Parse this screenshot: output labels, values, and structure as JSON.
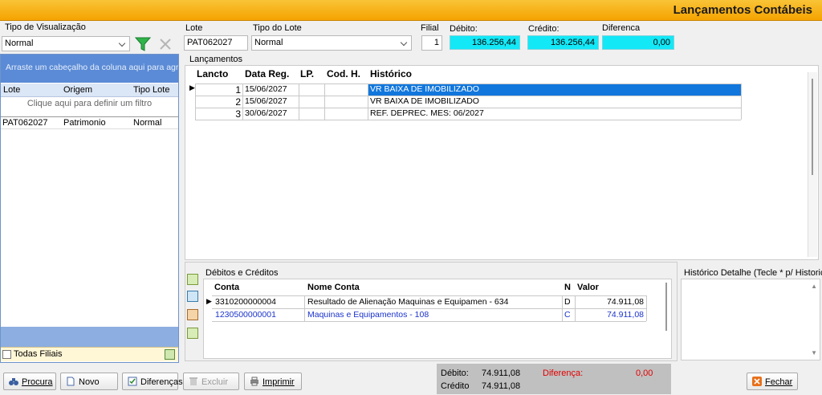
{
  "window": {
    "title": "Lançamentos Contábeis"
  },
  "left": {
    "view_label": "Tipo de Visualização",
    "view_value": "Normal",
    "group_hint": "Arraste um cabeçalho da coluna aqui para agrupar",
    "columns": [
      "Lote",
      "Origem",
      "Tipo Lote"
    ],
    "filter_hint": "Clique aqui para definir um filtro",
    "rows": [
      {
        "lote": "PAT062027",
        "origem": "Patrimonio",
        "tipo": "Normal"
      }
    ],
    "all_filiais_label": "Todas Filiais"
  },
  "header": {
    "lote_label": "Lote",
    "lote_value": "PAT062027",
    "tipo_label": "Tipo do Lote",
    "tipo_value": "Normal",
    "filial_label": "Filial",
    "filial_value": "1",
    "debito_label": "Débito:",
    "debito_value": "136.256,44",
    "credito_label": "Crédito:",
    "credito_value": "136.256,44",
    "diferenca_label": "Diferenca",
    "diferenca_value": "0,00"
  },
  "lancamentos": {
    "group_label": "Lançamentos",
    "columns": [
      "Lancto",
      "Data Reg.",
      "LP.",
      "Cod. H.",
      "Histórico"
    ],
    "rows": [
      {
        "lancto": "1",
        "data": "15/06/2027",
        "lp": "",
        "cod": "",
        "hist": "VR BAIXA DE IMOBILIZADO"
      },
      {
        "lancto": "2",
        "data": "15/06/2027",
        "lp": "",
        "cod": "",
        "hist": "VR BAIXA DE IMOBILIZADO"
      },
      {
        "lancto": "3",
        "data": "30/06/2027",
        "lp": "",
        "cod": "",
        "hist": "REF. DEPREC. MES: 06/2027"
      }
    ]
  },
  "debcred": {
    "group_label": "Débitos e Créditos",
    "columns": [
      "Conta",
      "Nome Conta",
      "N",
      "Valor"
    ],
    "rows": [
      {
        "conta": "3310200000004",
        "nome": "Resultado de Alienação Maquinas e Equipamen - 634",
        "n": "D",
        "valor": "74.911,08"
      },
      {
        "conta": "1230500000001",
        "nome": "Maquinas e Equipamentos - 108",
        "n": "C",
        "valor": "74.911,08"
      }
    ]
  },
  "historico_detalhe": {
    "label": "Histórico Detalhe (Tecle * p/ Historico Padrão)"
  },
  "toolbar": {
    "procura": "Procura",
    "novo": "Novo",
    "diferencas": "Diferenças",
    "excluir": "Excluir",
    "imprimir": "Imprimir",
    "fechar": "Fechar"
  },
  "status": {
    "debito_label": "Débito:",
    "debito_value": "74.911,08",
    "credito_label": "Crédito",
    "credito_value": "74.911,08",
    "diferenca_label": "Diferença:",
    "diferenca_value": "0,00"
  },
  "colors": {
    "accent": "#f5a300",
    "selection": "#1177dd",
    "highlight": "#13e8f7",
    "credit_text": "#1a33cc",
    "diff_text": "#e00000"
  }
}
